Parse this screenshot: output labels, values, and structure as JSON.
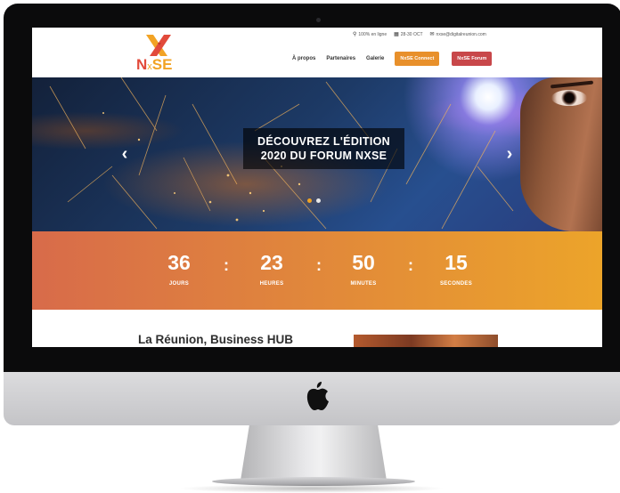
{
  "header": {
    "topbar": {
      "online": "100% en ligne",
      "dates": "28-30 OCT",
      "email": "nxse@digitalreunion.com"
    },
    "logo": {
      "part1": "N",
      "part2": "x",
      "part3": "SE"
    },
    "nav": {
      "about": "À propos",
      "partners": "Partenaires",
      "gallery": "Galerie",
      "connect_button": "NxSE Connect",
      "forum_button": "NxSE Forum"
    }
  },
  "hero": {
    "caption_line1": "DÉCOUVREZ L'ÉDITION",
    "caption_line2": "2020 DU FORUM NXSE",
    "prev_arrow": "‹",
    "next_arrow": "›",
    "slides_count": 2,
    "active_slide": 1
  },
  "countdown": {
    "days": {
      "value": "36",
      "label": "JOURS"
    },
    "hours": {
      "value": "23",
      "label": "HEURES"
    },
    "minutes": {
      "value": "50",
      "label": "MINUTES"
    },
    "seconds": {
      "value": "15",
      "label": "SECONDES"
    },
    "separator": ":"
  },
  "content": {
    "section_title": "La Réunion, Business HUB"
  },
  "colors": {
    "brand_orange": "#e8902b",
    "forum_red": "#c8474a",
    "logo_orange": "#f2a324",
    "logo_red": "#e24a3b",
    "dot_active": "#f0a323",
    "dot_inactive": "#e8e8e8"
  },
  "icons": {
    "location": "map-pin-icon",
    "calendar": "calendar-icon",
    "email": "envelope-icon",
    "device_logo": "apple-logo-icon"
  }
}
